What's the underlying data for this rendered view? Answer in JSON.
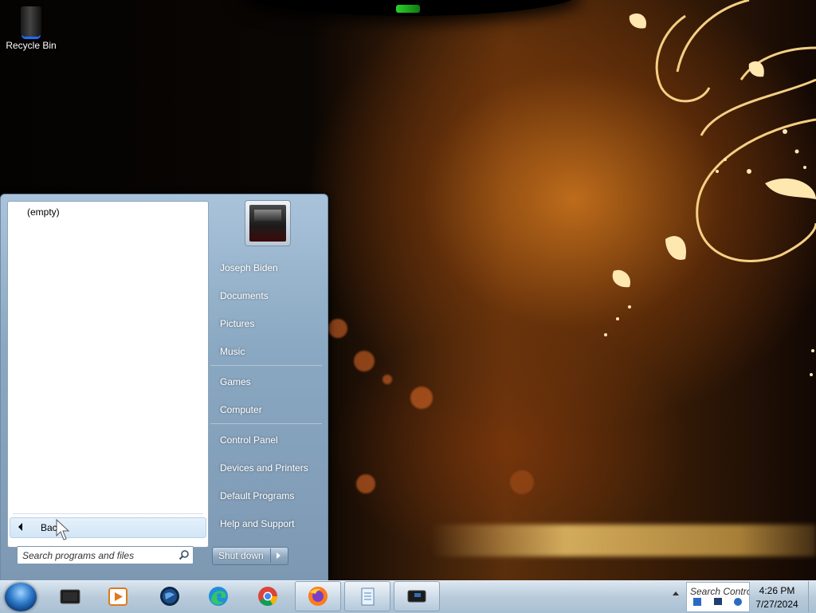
{
  "desktop": {
    "icons": [
      {
        "label": "Recycle Bin",
        "icon": "recycle-bin-icon"
      }
    ]
  },
  "start_menu": {
    "recent_programs_empty": "(empty)",
    "back_label": "Back",
    "search": {
      "placeholder": "Search programs and files",
      "value": ""
    },
    "user_picture": "user-picture",
    "right_links": [
      {
        "label": "Joseph Biden"
      },
      {
        "label": "Documents"
      },
      {
        "label": "Pictures"
      },
      {
        "label": "Music"
      },
      {
        "label": "Games"
      },
      {
        "label": "Computer"
      },
      {
        "label": "Control Panel"
      },
      {
        "label": "Devices and Printers"
      },
      {
        "label": "Default Programs"
      },
      {
        "label": "Help and Support"
      }
    ],
    "shutdown_label": "Shut down"
  },
  "taskbar": {
    "start_button": "start-orb",
    "pinned": [
      {
        "name": "tablet-pc-icon"
      },
      {
        "name": "media-player-icon"
      },
      {
        "name": "globe-icon"
      },
      {
        "name": "edge-icon"
      },
      {
        "name": "chrome-icon"
      },
      {
        "name": "firefox-icon",
        "active": true
      },
      {
        "name": "notepad-icon",
        "active": true
      },
      {
        "name": "remote-desktop-icon",
        "active": true
      }
    ],
    "tray_text": "Search Contro",
    "clock": {
      "time": "4:26 PM",
      "date": "7/27/2024"
    }
  }
}
